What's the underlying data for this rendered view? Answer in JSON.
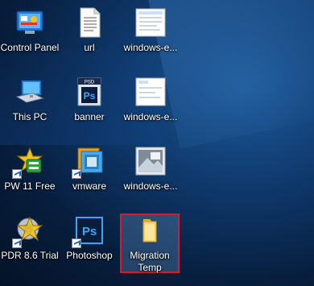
{
  "desktop": {
    "icons": [
      {
        "label": "Control Panel",
        "icon": "control-panel-icon",
        "shortcut": false
      },
      {
        "label": "url",
        "icon": "text-file-icon",
        "shortcut": false
      },
      {
        "label": "windows-e...",
        "icon": "image-file-icon",
        "shortcut": false
      },
      {
        "label": "This PC",
        "icon": "computer-icon",
        "shortcut": false
      },
      {
        "label": "banner",
        "icon": "photoshop-psd-icon",
        "shortcut": false
      },
      {
        "label": "windows-e...",
        "icon": "image-file-icon",
        "shortcut": false
      },
      {
        "label": "PW 11 Free",
        "icon": "partition-wizard-icon",
        "shortcut": true
      },
      {
        "label": "vmware",
        "icon": "vmware-icon",
        "shortcut": true
      },
      {
        "label": "windows-e...",
        "icon": "image-file-icon",
        "shortcut": false
      },
      {
        "label": "PDR 8.6 Trial",
        "icon": "power-data-recovery-icon",
        "shortcut": true
      },
      {
        "label": "Photoshop",
        "icon": "photoshop-app-icon",
        "shortcut": true
      },
      {
        "label": "Migration Temp",
        "icon": "folder-icon",
        "shortcut": false,
        "selected": true
      }
    ],
    "psd_badge": "PSD",
    "ps_letters": "Ps",
    "highlight_color": "#e8161b"
  }
}
